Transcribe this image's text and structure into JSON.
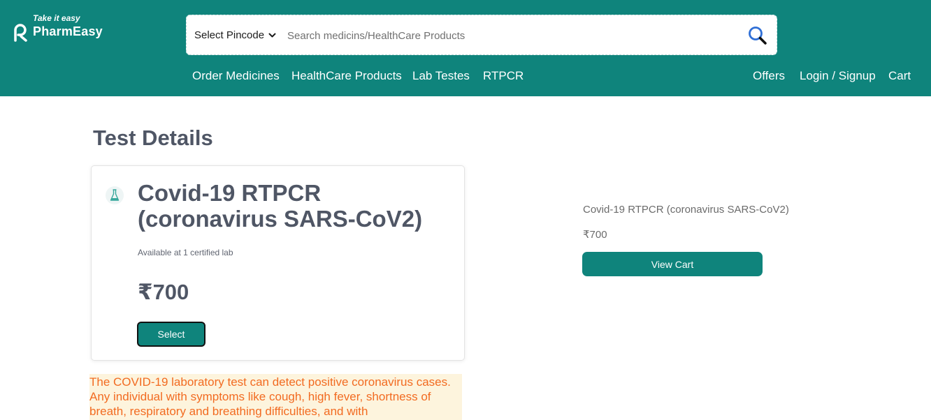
{
  "brand": {
    "tagline": "Take it easy",
    "name": "PharmEasy"
  },
  "search": {
    "pincode_label": "Select Pincode",
    "placeholder": "Search medicins/HealthCare Products"
  },
  "nav": {
    "left": [
      "Order Medicines",
      "HealthCare Products",
      "Lab Testes",
      "RTPCR"
    ],
    "right": [
      "Offers",
      "Login / Signup",
      "Cart"
    ]
  },
  "page": {
    "title": "Test Details"
  },
  "test": {
    "name": "Covid-19 RTPCR (coronavirus SARS-CoV2)",
    "availability": "Available at 1 certified lab",
    "price": "₹700",
    "select_label": "Select",
    "description": "The COVID-19 laboratory test can detect positive coronavirus cases. Any individual with symptoms like cough, high fever, shortness of breath, respiratory and breathing difficulties, and with"
  },
  "cart_summary": {
    "item_name": "Covid-19 RTPCR (coronavirus SARS-CoV2)",
    "item_price": "₹700",
    "view_cart_label": "View Cart"
  },
  "colors": {
    "brand_teal": "#0f847c",
    "text_dark": "#4f5665",
    "description_text": "#f26b21",
    "description_bg": "#fdf4dd"
  }
}
